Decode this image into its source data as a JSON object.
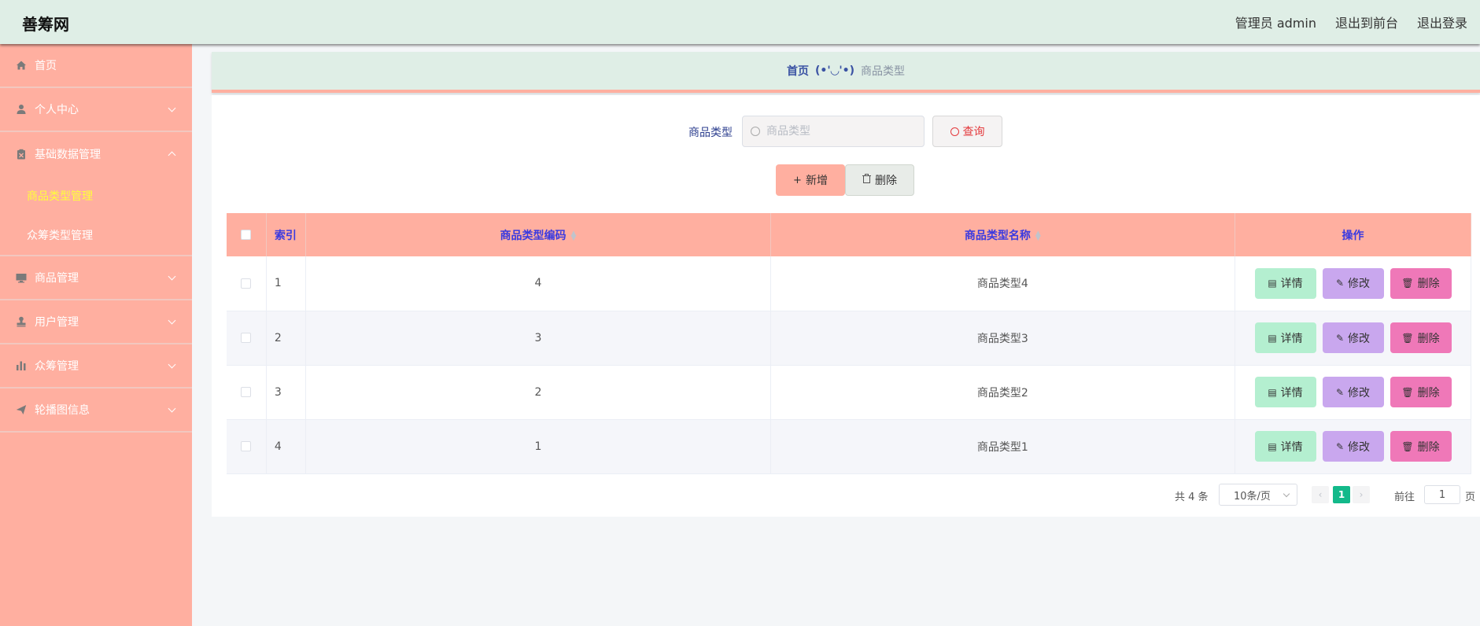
{
  "header": {
    "brand": "善筹网",
    "admin": "管理员 admin",
    "to_front": "退出到前台",
    "logout": "退出登录"
  },
  "sidebar": {
    "items": [
      {
        "label": "首页",
        "icon": "home-icon"
      },
      {
        "label": "个人中心",
        "icon": "user-icon"
      },
      {
        "label": "基础数据管理",
        "icon": "clipboard-icon"
      },
      {
        "label": "商品管理",
        "icon": "monitor-icon"
      },
      {
        "label": "用户管理",
        "icon": "stamp-icon"
      },
      {
        "label": "众筹管理",
        "icon": "bar-chart-icon"
      },
      {
        "label": "轮播图信息",
        "icon": "send-icon"
      }
    ],
    "submenu": [
      {
        "label": "商品类型管理"
      },
      {
        "label": "众筹类型管理"
      }
    ],
    "active_color": "#ffff3a"
  },
  "breadcrumb": {
    "home": "首页",
    "sep": "(•'◡'•)",
    "current": "商品类型"
  },
  "search": {
    "label": "商品类型",
    "placeholder": "商品类型",
    "query_label": "查询"
  },
  "actions": {
    "add_label": "新增",
    "delete_label": "删除"
  },
  "table": {
    "headers": {
      "index": "索引",
      "code": "商品类型编码",
      "name": "商品类型名称",
      "ops": "操作"
    },
    "rows": [
      {
        "index": "1",
        "code": "4",
        "name": "商品类型4"
      },
      {
        "index": "2",
        "code": "3",
        "name": "商品类型3"
      },
      {
        "index": "3",
        "code": "2",
        "name": "商品类型2"
      },
      {
        "index": "4",
        "code": "1",
        "name": "商品类型1"
      }
    ],
    "op_labels": {
      "detail": "详情",
      "edit": "修改",
      "remove": "删除"
    }
  },
  "pagination": {
    "total": "共 4 条",
    "page_size": "10条/页",
    "current_page": "1",
    "goto_label": "前往",
    "goto_value": "1",
    "page_suffix": "页"
  },
  "colors": {
    "accent": "#ffafa0",
    "header_bg": "#dfeee6",
    "page_active": "#13b98a"
  }
}
